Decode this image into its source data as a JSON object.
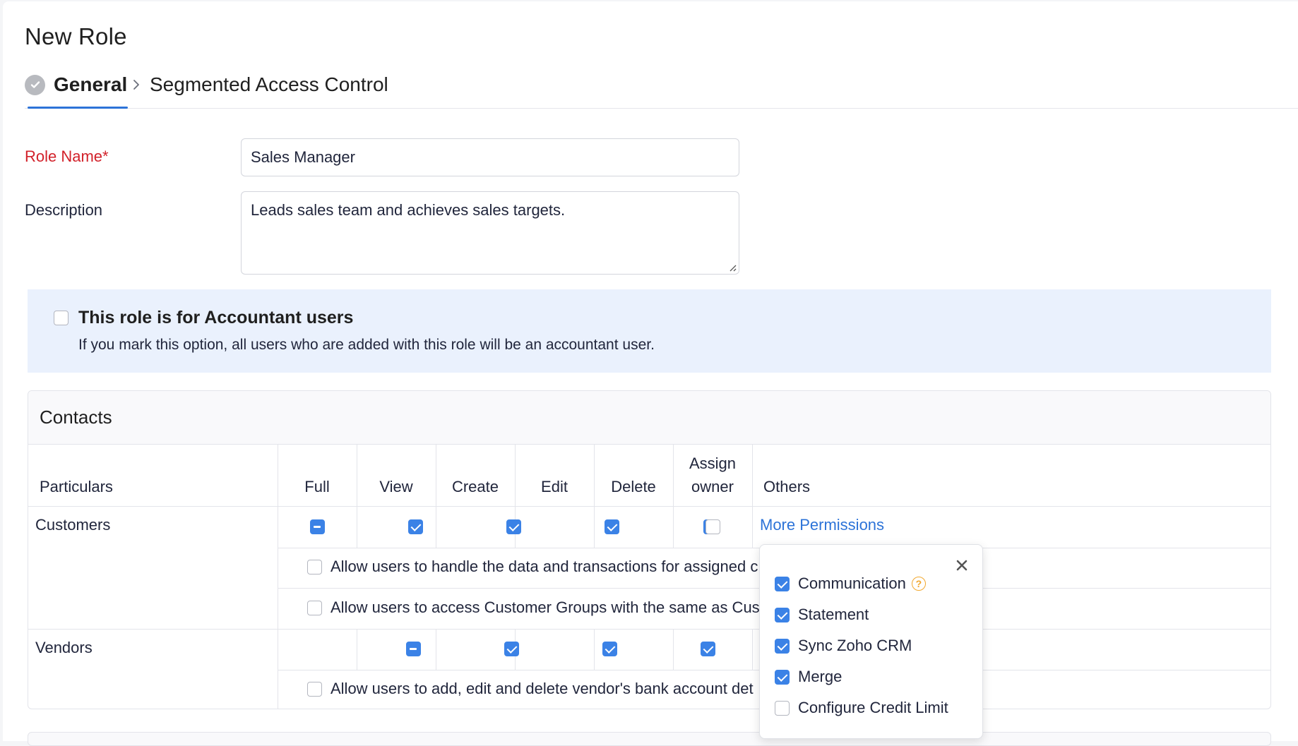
{
  "page": {
    "title": "New Role"
  },
  "steps": [
    {
      "label": "General",
      "state": "completed"
    },
    {
      "label": "Segmented Access Control",
      "state": "pending"
    }
  ],
  "form": {
    "role_name": {
      "label": "Role Name*",
      "value": "Sales Manager"
    },
    "description": {
      "label": "Description",
      "value": "Leads sales team and achieves sales targets."
    }
  },
  "accountant": {
    "checked": false,
    "title": "This role is for Accountant users",
    "description": "If you mark this option, all users who are added with this role will be an accountant user."
  },
  "contacts": {
    "title": "Contacts",
    "columns": {
      "particulars": "Particulars",
      "full": "Full",
      "view": "View",
      "create": "Create",
      "edit": "Edit",
      "delete": "Delete",
      "assign_owner_1": "Assign",
      "assign_owner_2": "owner",
      "others": "Others"
    },
    "customers": {
      "label": "Customers",
      "full": "partial",
      "view": true,
      "create": true,
      "edit": true,
      "delete": true,
      "assign_owner": false,
      "more_permissions": "More Permissions",
      "options": [
        {
          "label": "Allow users to handle the data and transactions for assigned c",
          "checked": false
        },
        {
          "label": "Allow users to access Customer Groups with the same as Cus",
          "checked": false
        }
      ]
    },
    "vendors": {
      "label": "Vendors",
      "full": "partial",
      "view": true,
      "create": true,
      "edit": true,
      "delete": true,
      "options": [
        {
          "label": "Allow users to add, edit and delete vendor's bank account det",
          "checked": false
        }
      ]
    }
  },
  "more_permissions_popup": {
    "items": [
      {
        "label": "Communication",
        "checked": true,
        "help": "?"
      },
      {
        "label": "Statement",
        "checked": true
      },
      {
        "label": "Sync Zoho CRM",
        "checked": true
      },
      {
        "label": "Merge",
        "checked": true
      },
      {
        "label": "Configure Credit Limit",
        "checked": false
      }
    ]
  },
  "colors": {
    "accent": "#2c73d8",
    "required": "#d2212a",
    "checkbox": "#3b82e6",
    "banner": "#eaf1fd",
    "help": "#f2a82f"
  }
}
